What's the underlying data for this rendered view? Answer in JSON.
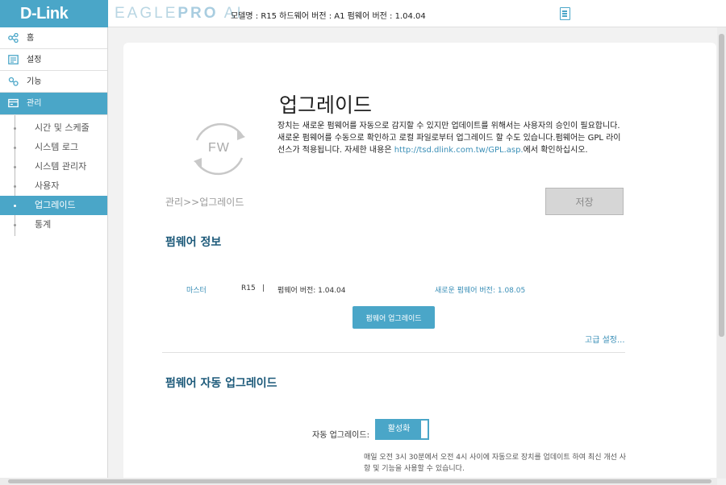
{
  "header": {
    "brand": "D-Link",
    "product_light": "EAGLE",
    "product_bold": "PRO",
    "product_suffix": " AI",
    "model_info": "모델명 : R15 하드웨어 버전 : A1 펌웨어 버전 : 1.04.04"
  },
  "sidebar": {
    "items": [
      {
        "label": "홈",
        "icon": "network-icon"
      },
      {
        "label": "설정",
        "icon": "settings-icon"
      },
      {
        "label": "기능",
        "icon": "features-icon"
      },
      {
        "label": "관리",
        "icon": "management-icon"
      }
    ],
    "sub_items": [
      "시간 및 스케줄",
      "시스템 로그",
      "시스템 관리자",
      "사용자",
      "업그레이드",
      "통계"
    ],
    "active_sub": "업그레이드"
  },
  "main": {
    "fw_icon_text": "FW",
    "title": "업그레이드",
    "description": "장치는 새로운 펌웨어를 자동으로 감지할 수 있지만 업데이트를 위해서는 사용자의 승인이 필요합니다. 새로운 펌웨어를 수동으로 확인하고 로컬 파일로부터 업그레이드 할 수도 있습니다.펌웨어는 GPL 라이선스가 적용됩니다. 자세한 내용은 ",
    "gpl_link": "http://tsd.dlink.com.tw/GPL.asp.",
    "description_end": "에서 확인하십시오.",
    "breadcrumb": "관리>>업그레이드",
    "save_label": "저장"
  },
  "firmware_info": {
    "title": "펌웨어 정보",
    "device_role": "마스터",
    "model": "R15",
    "separator": "|",
    "current_version": "펌웨어 버전: 1.04.04",
    "new_version": "새로운 펌웨어 버전: 1.08.05",
    "upgrade_button": "펌웨어 업그레이드",
    "advanced_link": "고급 설정..."
  },
  "auto_upgrade": {
    "title": "펌웨어 자동 업그레이드",
    "label": "자동 업그레이드:",
    "toggle_state": "활성화",
    "schedule_text": "매일 오전 3시 30분에서 오전 4시 사이에 자동으로 장치를 업데이트 하여 최신 개선 사항 및 기능을 사용할 수 있습니다."
  },
  "colors": {
    "accent": "#4aa6c8",
    "section_title": "#1d5a7a",
    "link": "#3a8fb7"
  }
}
